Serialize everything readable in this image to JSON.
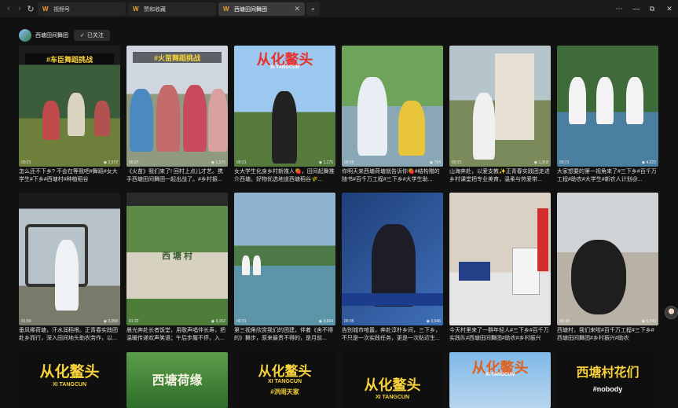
{
  "tabs": [
    {
      "label": "视频号",
      "active": false
    },
    {
      "label": "赞和收藏",
      "active": false
    },
    {
      "label": "西塘田间舞团",
      "active": true
    }
  ],
  "profile": {
    "name": "西塘田间舞团",
    "follow_label": "已关注"
  },
  "videos": [
    {
      "duration": "00:21",
      "likes": "2,572",
      "caption": "怎么还不下乡? 不会在等我吧#舞蹈#女大学生#下乡#西塘村#种植稻谷",
      "overlay": "#车臣舞蹈挑战"
    },
    {
      "duration": "00:27",
      "likes": "1,575",
      "caption": "《火苗》我们来了! 回村上点儿才艺。携手西塘田间舞团一起出战了。#乡村振...",
      "overlay": "#火苗舞蹈挑战"
    },
    {
      "duration": "00:21",
      "likes": "1,175",
      "caption": "女大学生化身乡村新媒人🍓，田间起舞推介西塘。好物优选地道西塘稻谷🌾...",
      "overlay": "从化鳌头",
      "overlay_sub": "XI TANGCUN"
    },
    {
      "duration": "00:25",
      "likes": "794",
      "caption": "你明天来西塘荷塘就告诉你🍓#结构赠的随书#百千万工程#三下乡#大学生助...",
      "overlay": ""
    },
    {
      "duration": "00:21",
      "likes": "1,318",
      "caption": "山海奔赴，以爱支教✨正青春实践团走进乡村课堂把专业美育，温柔与热爱带...",
      "overlay": ""
    },
    {
      "duration": "00:21",
      "likes": "4,022",
      "caption": "大家想要的第一视角来了#三下乡#百千万工程#助农#大学生#新农人计划@...",
      "overlay": ""
    },
    {
      "duration": "01:59",
      "likes": "3,058",
      "caption": "垂风稀荷塘，汗水润稻根。正青春实践团赴乡而行，深入田间地头助农劳作，以...",
      "overlay": ""
    },
    {
      "duration": "01:22",
      "likes": "3,152",
      "caption": "晨光奔赴长者饭堂，用歌声唱伴长寿，把温暖传递欢声笑语；午后步履不停，入...",
      "overlay": ""
    },
    {
      "duration": "00:31",
      "likes": "3,694",
      "caption": "第三视角欣赏我们的团建，伴着《舍不得的》舞步，原来最贵不得的，是月前...",
      "overlay": ""
    },
    {
      "duration": "00:35",
      "likes": "3,946",
      "caption": "告别城市喧嚣，奔赴淳朴乡间，三下乡，不只是一次实践任务，更是一次贴近生...",
      "overlay": ""
    },
    {
      "duration": "00:16",
      "likes": "1,375",
      "caption": "今天村里来了一群年轻人#三下乡#百千万实践队#西塘田间舞团#助农#乡村振兴",
      "overlay": ""
    },
    {
      "duration": "00:18",
      "likes": "5,743",
      "caption": "西塘村，我们来啦#百千万工程#三下乡#西塘田间舞团#乡村振兴#助农",
      "overlay": ""
    },
    {
      "duration": "",
      "likes": "",
      "caption": "",
      "overlay": "从化鳌头",
      "overlay_sub": "XI TANGCUN"
    },
    {
      "duration": "",
      "likes": "",
      "caption": "",
      "overlay": "西塘荷缘"
    },
    {
      "duration": "",
      "likes": "",
      "caption": "",
      "overlay": "从化鳌头",
      "overlay_sub": "XI TANGCUN",
      "overlay_sub2": "#洪闹天家"
    },
    {
      "duration": "",
      "likes": "",
      "caption": "",
      "overlay": "从化鳌头",
      "overlay_sub": "XI TANGCUN"
    },
    {
      "duration": "",
      "likes": "",
      "caption": "",
      "overlay": "从化鳌头",
      "overlay_sub": "XI TANGCUN"
    },
    {
      "duration": "",
      "likes": "",
      "caption": "",
      "overlay": "西塘村花们",
      "overlay_sub": "#nobody"
    }
  ],
  "icons": {
    "back": "arrow-left-icon",
    "forward": "arrow-right-icon",
    "refresh": "refresh-icon",
    "search": "search-icon",
    "close": "close-icon"
  },
  "colors": {
    "accent": "#f7d23a",
    "background": "#111111"
  }
}
